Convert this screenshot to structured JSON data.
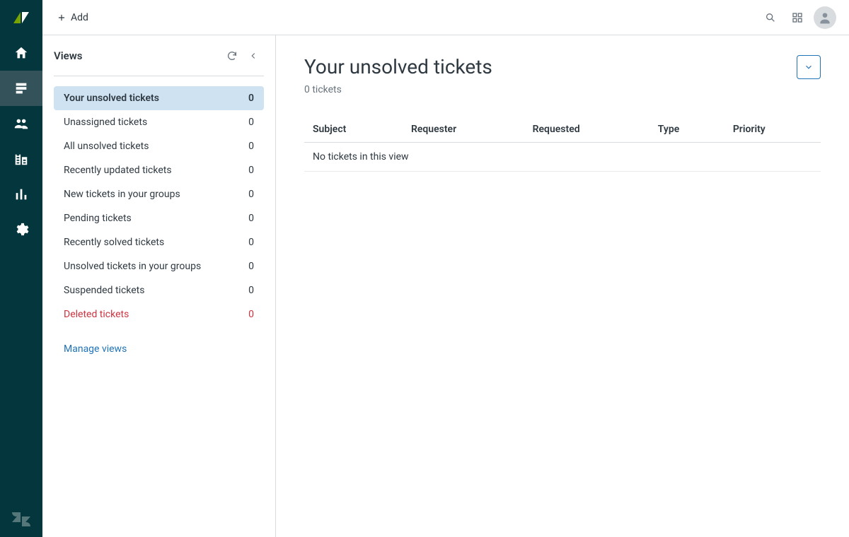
{
  "topbar": {
    "add_label": "Add"
  },
  "sidebar": {
    "title": "Views",
    "items": [
      {
        "label": "Your unsolved tickets",
        "count": "0",
        "active": true
      },
      {
        "label": "Unassigned tickets",
        "count": "0"
      },
      {
        "label": "All unsolved tickets",
        "count": "0"
      },
      {
        "label": "Recently updated tickets",
        "count": "0"
      },
      {
        "label": "New tickets in your groups",
        "count": "0"
      },
      {
        "label": "Pending tickets",
        "count": "0"
      },
      {
        "label": "Recently solved tickets",
        "count": "0"
      },
      {
        "label": "Unsolved tickets in your groups",
        "count": "0"
      },
      {
        "label": "Suspended tickets",
        "count": "0"
      },
      {
        "label": "Deleted tickets",
        "count": "0",
        "danger": true
      }
    ],
    "manage_link": "Manage views"
  },
  "main": {
    "title": "Your unsolved tickets",
    "subtitle": "0 tickets",
    "columns": [
      "Subject",
      "Requester",
      "Requested",
      "Type",
      "Priority"
    ],
    "empty_message": "No tickets in this view"
  }
}
